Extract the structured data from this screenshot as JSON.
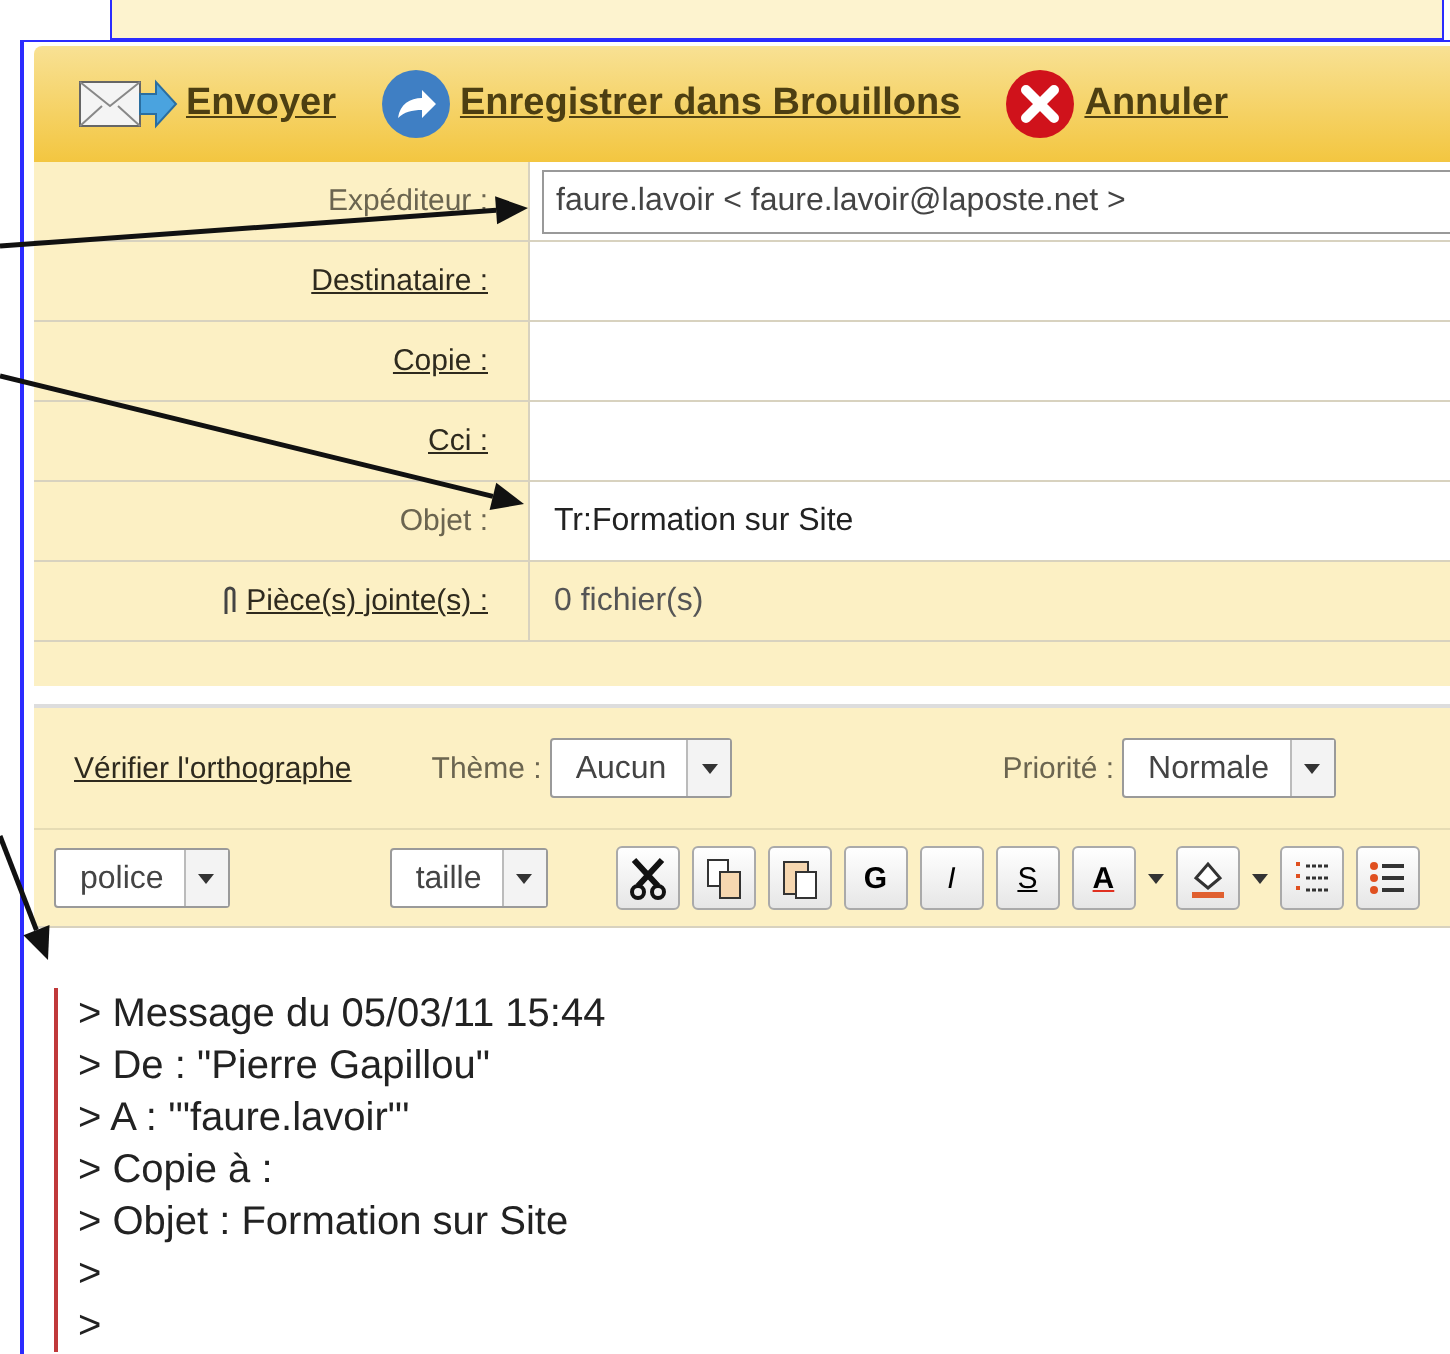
{
  "toolbar": [
    {
      "kind": "send",
      "label": "Envoyer"
    },
    {
      "kind": "save",
      "label": "Enregistrer dans Brouillons"
    },
    {
      "kind": "cancel",
      "label": "Annuler"
    }
  ],
  "fields": [
    {
      "label": "Expéditeur :",
      "link": false,
      "kind": "sender",
      "value": "faure.lavoir < faure.lavoir@laposte.net >"
    },
    {
      "label": "Destinataire :",
      "link": true,
      "kind": "text"
    },
    {
      "label": "Copie :",
      "link": true,
      "kind": "text"
    },
    {
      "label": "Cci :",
      "link": true,
      "kind": "text"
    },
    {
      "label": "Objet :",
      "link": false,
      "kind": "text",
      "value": "Tr:Formation sur Site"
    },
    {
      "label": "Pièce(s) jointe(s) :",
      "link": true,
      "kind": "attachment",
      "value": "0 fichier(s)"
    }
  ],
  "options": {
    "spellcheck": "Vérifier l'orthographe",
    "theme": {
      "label": "Thème :",
      "value": "Aucun"
    },
    "priority": {
      "label": "Priorité :",
      "value": "Normale"
    }
  },
  "format_bar": {
    "font": "police",
    "size": "taille",
    "buttons": [
      {
        "kind": "cut"
      },
      {
        "kind": "copy"
      },
      {
        "kind": "paste"
      },
      {
        "kind": "bold",
        "label": "G"
      },
      {
        "kind": "italic",
        "label": "I"
      },
      {
        "kind": "strike",
        "label": "S"
      },
      {
        "kind": "color",
        "label": "A"
      },
      {
        "kind": "highlight"
      },
      {
        "kind": "numbered"
      },
      {
        "kind": "bullets"
      }
    ]
  },
  "quote": [
    "> Message du 05/03/11 15:44",
    "> De : \"Pierre Gapillou\"",
    "> A : '\"faure.lavoir\"'",
    "> Copie à :",
    "> Objet : Formation sur Site",
    ">",
    ">"
  ]
}
